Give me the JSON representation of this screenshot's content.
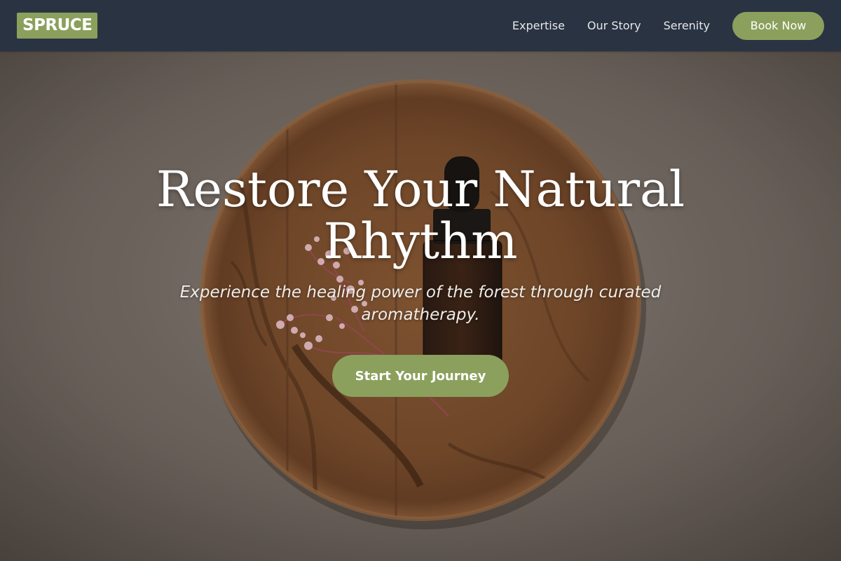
{
  "header": {
    "logo": "SPRUCE",
    "nav": [
      {
        "label": "Expertise"
      },
      {
        "label": "Our Story"
      },
      {
        "label": "Serenity"
      }
    ],
    "book_button": "Book Now"
  },
  "hero": {
    "title": "Restore Your Natural Rhythm",
    "subtitle": "Experience the healing power of the forest through curated aromatherapy.",
    "cta": "Start Your Journey",
    "background_image": "wooden plate with essential oil dropper bottle and dried pink flowers on beige linen"
  },
  "colors": {
    "header_bg": "#2a3342",
    "accent_green": "#8ba05d",
    "hero_text": "#ffffff"
  }
}
